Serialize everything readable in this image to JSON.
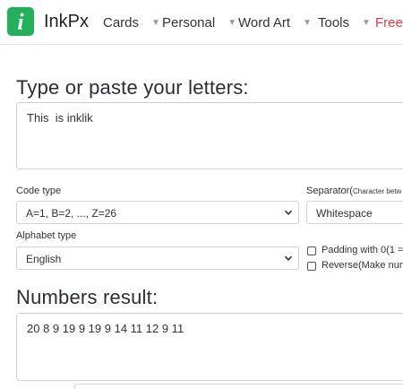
{
  "nav": {
    "brand": "InkPx",
    "logo_glyph": "i",
    "items": [
      {
        "label": "Cards",
        "icon": "caret-down-icon"
      },
      {
        "label": "Personal",
        "icon": "caret-down-icon"
      },
      {
        "label": "Word Art",
        "icon": "caret-down-icon"
      },
      {
        "label": "Tools",
        "icon": "caret-down-icon"
      }
    ],
    "free_label": "Free",
    "caret": "▼"
  },
  "input": {
    "heading": "Type or paste your letters:",
    "value": "This  is inklik"
  },
  "options": {
    "code_type_label": "Code type",
    "code_type_value": "A=1, B=2, ..., Z=26",
    "alphabet_type_label": "Alphabet type",
    "alphabet_type_value": "English",
    "separator_label": "Separator(",
    "separator_hint": "Character betw",
    "separator_value": "Whitespace",
    "padding_label": "Padding with 0(1 =",
    "reverse_label": "Reverse(Make num"
  },
  "output": {
    "heading": "Numbers result:",
    "value": "20 8 9 19 9 19 9 14 11 12 9 11"
  },
  "colors": {
    "brand_green": "#20b15a",
    "free_red": "#e53935"
  }
}
